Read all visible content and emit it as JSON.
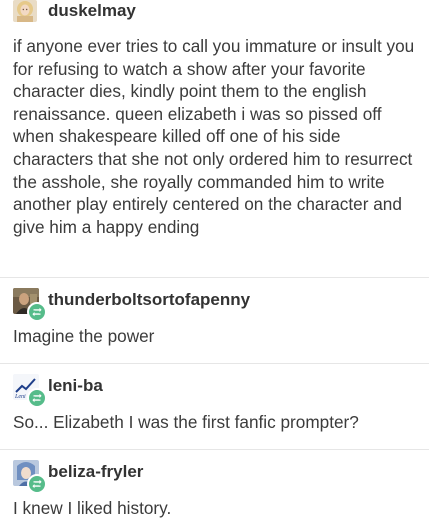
{
  "posts": [
    {
      "username": "duskelmay",
      "avatar_icon": "blonde-portrait-avatar-icon",
      "text": "if anyone ever tries to call you immature or insult you for refusing to watch a show after your favorite character dies, kindly point them to the english renaissance. queen elizabeth i was so pissed off when shakespeare killed off one of his side characters that she not only ordered him to resurrect the asshole, she royally commanded him to write another play entirely centered on the character and give him a happy ending"
    },
    {
      "username": "thunderboltsortofapenny",
      "avatar_icon": "portrait-avatar-icon",
      "text": "Imagine the power"
    },
    {
      "username": "leni-ba",
      "avatar_icon": "leni-logo-avatar-icon",
      "text": "So... Elizabeth I was the first fanfic prompter?"
    },
    {
      "username": "beliza-fryler",
      "avatar_icon": "anime-character-avatar-icon",
      "text": "I knew I liked history."
    }
  ],
  "colors": {
    "reblog_badge": "#56bc8a",
    "divider": "#e6e6e6",
    "text": "#3b3b3b"
  }
}
